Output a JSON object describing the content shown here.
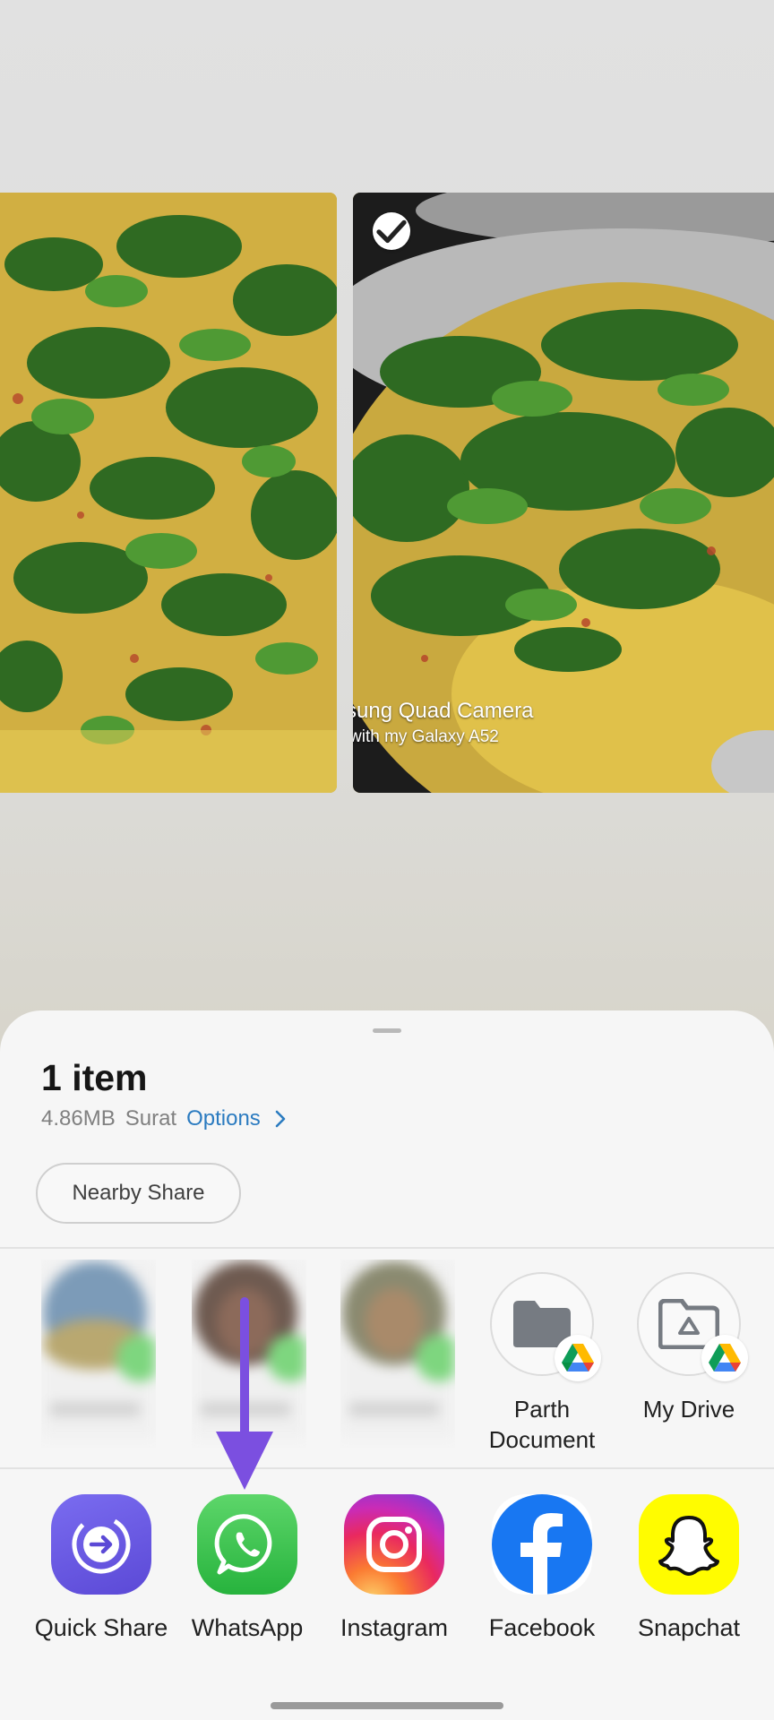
{
  "sheet": {
    "title": "1 item",
    "size": "4.86MB",
    "location": "Surat",
    "options_label": "Options",
    "nearby_share_label": "Nearby Share"
  },
  "preview": {
    "watermark_line1": "sung Quad Camera",
    "watermark_line2": "with my Galaxy A52"
  },
  "direct_share": [
    {
      "label": "Parth\nDocument",
      "badge": "google-drive-icon",
      "icon": "folder-icon"
    },
    {
      "label": "My Drive",
      "badge": "google-drive-icon",
      "icon": "drive-folder-icon"
    }
  ],
  "apps": [
    {
      "label": "Quick Share",
      "icon": "quick-share-icon"
    },
    {
      "label": "WhatsApp",
      "icon": "whatsapp-icon"
    },
    {
      "label": "Instagram",
      "icon": "instagram-icon"
    },
    {
      "label": "Facebook",
      "icon": "facebook-icon"
    },
    {
      "label": "Snapchat",
      "icon": "snapchat-icon"
    }
  ],
  "colors": {
    "accent_link": "#2b7bc0",
    "arrow": "#7b4fe0"
  }
}
